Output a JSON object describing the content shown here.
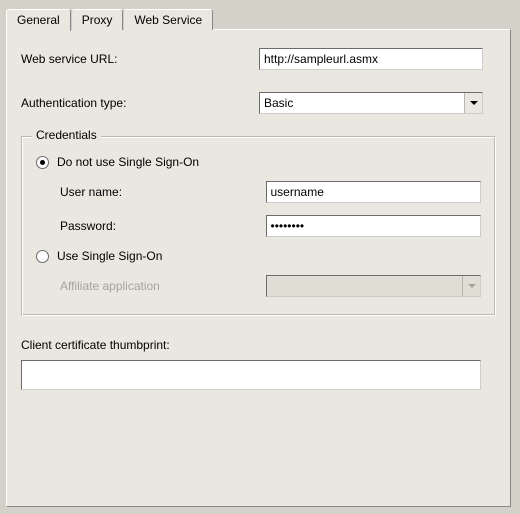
{
  "tabs": {
    "general": "General",
    "proxy": "Proxy",
    "webservice": "Web Service"
  },
  "labels": {
    "url": "Web service URL:",
    "authType": "Authentication type:",
    "credentialsLegend": "Credentials",
    "noSso": "Do not use Single Sign-On",
    "userName": "User name:",
    "password": "Password:",
    "useSso": "Use Single Sign-On",
    "affiliate": "Affiliate application",
    "thumbprint": "Client certificate thumbprint:"
  },
  "values": {
    "url": "http://sampleurl.asmx",
    "authType": "Basic",
    "userName": "username",
    "password": "••••••••",
    "affiliate": "",
    "thumbprint": ""
  }
}
